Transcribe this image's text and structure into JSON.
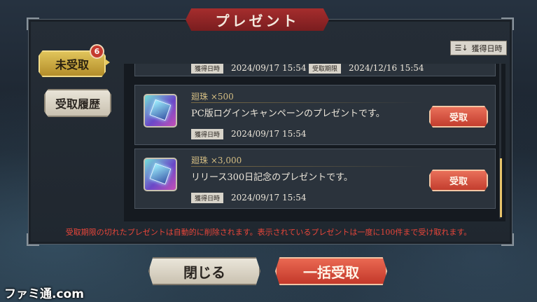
{
  "header": {
    "title": "プレゼント"
  },
  "tabs": {
    "unclaimed": {
      "label": "未受取",
      "badge": "6"
    },
    "history": {
      "label": "受取履歴"
    }
  },
  "sort": {
    "label": "獲得日時",
    "icon": "sort-icon"
  },
  "list": {
    "partial_row": {
      "acquired_label": "獲得日時",
      "acquired_date": "2024/09/17 15:54",
      "deadline_label": "受取期限",
      "deadline_date": "2024/12/16 15:54"
    },
    "items": [
      {
        "name": "廻珠 ×500",
        "description": "PC版ログインキャンペーンのプレゼントです。",
        "acquired_label": "獲得日時",
        "acquired_date": "2024/09/17 15:54",
        "claim_label": "受取",
        "icon": "gem-icon"
      },
      {
        "name": "廻珠 ×3,000",
        "description": "リリース300日記念のプレゼントです。",
        "acquired_label": "獲得日時",
        "acquired_date": "2024/09/17 15:54",
        "claim_label": "受取",
        "icon": "gem-icon"
      }
    ]
  },
  "notice": "受取期限の切れたプレゼントは自動的に削除されます。表示されているプレゼントは一度に100件まで受け取れます。",
  "footer": {
    "close_label": "閉じる",
    "claim_all_label": "一括受取"
  },
  "watermark": "ファミ通.com",
  "colors": {
    "accent_red": "#c33d2e",
    "accent_gold": "#e0c45a",
    "notice_red": "#e8463a"
  }
}
